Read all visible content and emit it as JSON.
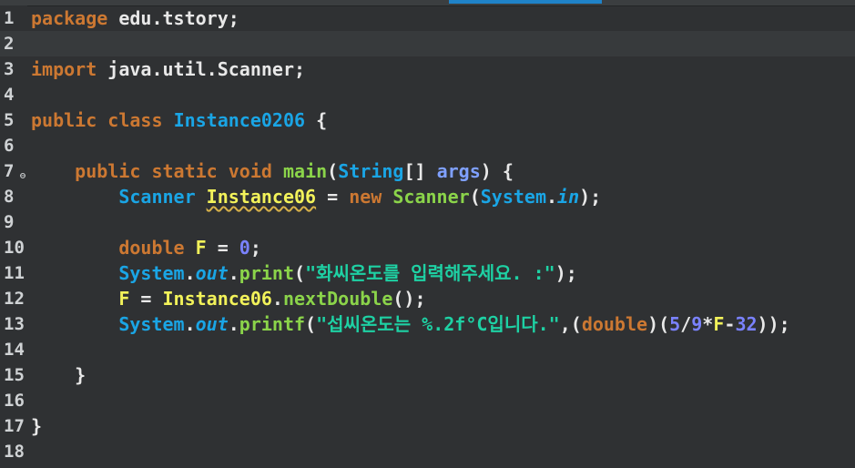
{
  "editor": {
    "lines": [
      {
        "n": "1",
        "tokens": [
          [
            "kw",
            "package"
          ],
          [
            "plain",
            " edu.tstory;"
          ]
        ]
      },
      {
        "n": "2",
        "tokens": []
      },
      {
        "n": "3",
        "tokens": [
          [
            "kw",
            "import"
          ],
          [
            "plain",
            " java.util.Scanner;"
          ]
        ]
      },
      {
        "n": "4",
        "tokens": []
      },
      {
        "n": "5",
        "tokens": [
          [
            "kw",
            "public"
          ],
          [
            "plain",
            " "
          ],
          [
            "kw",
            "class"
          ],
          [
            "plain",
            " "
          ],
          [
            "cls",
            "Instance0206"
          ],
          [
            "plain",
            " {"
          ]
        ]
      },
      {
        "n": "6",
        "tokens": []
      },
      {
        "n": "7",
        "fold": "⊖",
        "tokens": [
          [
            "plain",
            "    "
          ],
          [
            "kw",
            "public"
          ],
          [
            "plain",
            " "
          ],
          [
            "kw",
            "static"
          ],
          [
            "plain",
            " "
          ],
          [
            "kw",
            "void"
          ],
          [
            "plain",
            " "
          ],
          [
            "method",
            "main"
          ],
          [
            "plain",
            "("
          ],
          [
            "type",
            "String"
          ],
          [
            "plain",
            "[] "
          ],
          [
            "param",
            "args"
          ],
          [
            "plain",
            ") {"
          ]
        ]
      },
      {
        "n": "8",
        "tokens": [
          [
            "plain",
            "        "
          ],
          [
            "type",
            "Scanner"
          ],
          [
            "plain",
            " "
          ],
          [
            "var-u",
            "Instance06"
          ],
          [
            "plain",
            " = "
          ],
          [
            "kw",
            "new"
          ],
          [
            "plain",
            " "
          ],
          [
            "method",
            "Scanner"
          ],
          [
            "plain",
            "("
          ],
          [
            "type",
            "System"
          ],
          [
            "plain",
            "."
          ],
          [
            "field",
            "in"
          ],
          [
            "plain",
            ");"
          ]
        ]
      },
      {
        "n": "9",
        "tokens": []
      },
      {
        "n": "10",
        "tokens": [
          [
            "plain",
            "        "
          ],
          [
            "kw",
            "double"
          ],
          [
            "plain",
            " "
          ],
          [
            "var",
            "F"
          ],
          [
            "plain",
            " = "
          ],
          [
            "num",
            "0"
          ],
          [
            "plain",
            ";"
          ]
        ]
      },
      {
        "n": "11",
        "tokens": [
          [
            "plain",
            "        "
          ],
          [
            "type",
            "System"
          ],
          [
            "plain",
            "."
          ],
          [
            "field",
            "out"
          ],
          [
            "plain",
            "."
          ],
          [
            "method",
            "print"
          ],
          [
            "plain",
            "("
          ],
          [
            "str",
            "\"화씨온도를 입력해주세요. :\""
          ],
          [
            "plain",
            ");"
          ]
        ]
      },
      {
        "n": "12",
        "tokens": [
          [
            "plain",
            "        "
          ],
          [
            "var",
            "F"
          ],
          [
            "plain",
            " = "
          ],
          [
            "var",
            "Instance06"
          ],
          [
            "plain",
            "."
          ],
          [
            "method",
            "nextDouble"
          ],
          [
            "plain",
            "();"
          ]
        ]
      },
      {
        "n": "13",
        "tokens": [
          [
            "plain",
            "        "
          ],
          [
            "type",
            "System"
          ],
          [
            "plain",
            "."
          ],
          [
            "field",
            "out"
          ],
          [
            "plain",
            "."
          ],
          [
            "method",
            "printf"
          ],
          [
            "plain",
            "("
          ],
          [
            "str",
            "\"섭씨온도는 %.2f°C입니다.\""
          ],
          [
            "plain",
            ",("
          ],
          [
            "kw",
            "double"
          ],
          [
            "plain",
            ")("
          ],
          [
            "num",
            "5"
          ],
          [
            "plain",
            "/"
          ],
          [
            "num",
            "9"
          ],
          [
            "plain",
            "*"
          ],
          [
            "var",
            "F"
          ],
          [
            "plain",
            "-"
          ],
          [
            "num",
            "32"
          ],
          [
            "plain",
            "));"
          ]
        ]
      },
      {
        "n": "14",
        "tokens": []
      },
      {
        "n": "15",
        "tokens": [
          [
            "plain",
            "    }"
          ]
        ]
      },
      {
        "n": "16",
        "tokens": []
      },
      {
        "n": "17",
        "tokens": [
          [
            "plain",
            "}"
          ]
        ]
      },
      {
        "n": "18",
        "tokens": []
      }
    ],
    "current_line": "2"
  }
}
